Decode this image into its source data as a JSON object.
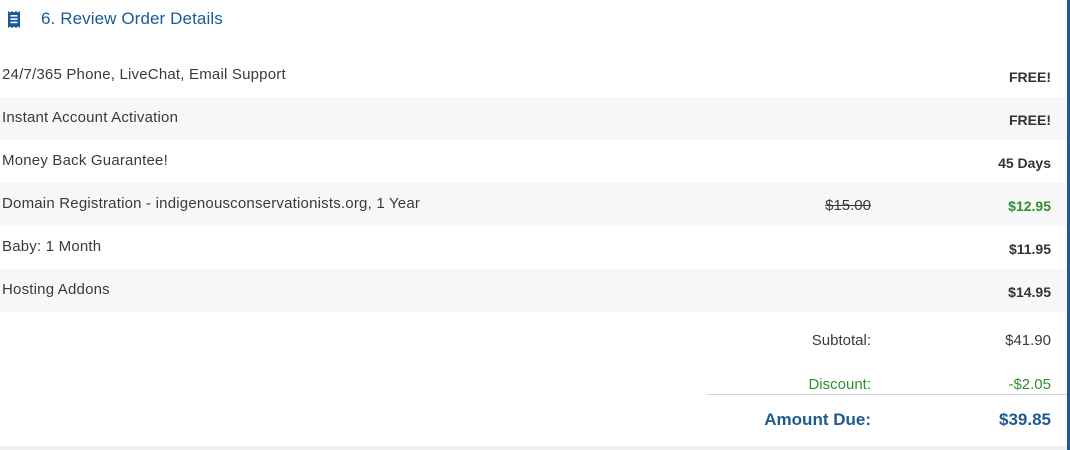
{
  "section": {
    "title": "6. Review Order Details",
    "icon": "receipt-icon",
    "accent_color": "#1a5a96"
  },
  "items": [
    {
      "label": "24/7/365 Phone, LiveChat, Email Support",
      "original_price": "",
      "price": "FREE!"
    },
    {
      "label": "Instant Account Activation",
      "original_price": "",
      "price": "FREE!"
    },
    {
      "label": "Money Back Guarantee!",
      "original_price": "",
      "price": "45 Days"
    },
    {
      "label": "Domain Registration - indigenousconservationists.org, 1 Year",
      "original_price": "$15.00",
      "price": "$12.95"
    },
    {
      "label": "Baby: 1 Month",
      "original_price": "",
      "price": "$11.95"
    },
    {
      "label": "Hosting Addons",
      "original_price": "",
      "price": "$14.95"
    }
  ],
  "totals": {
    "subtotal_label": "Subtotal:",
    "subtotal_value": "$41.90",
    "discount_label": "Discount:",
    "discount_value": "-$2.05",
    "amount_due_label": "Amount Due:",
    "amount_due_value": "$39.85"
  },
  "colors": {
    "discount_green": "#2f8f2f",
    "total_blue": "#1f5b8e"
  }
}
